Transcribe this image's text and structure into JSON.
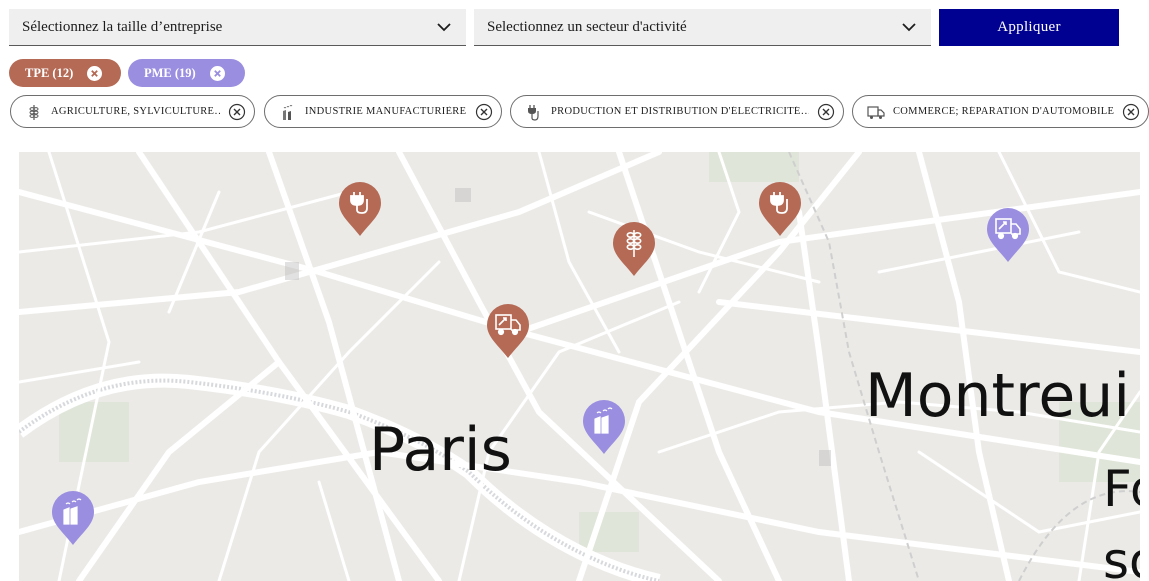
{
  "filters": {
    "size_select": {
      "label": "Sélectionnez la taille d’entreprise"
    },
    "sector_select": {
      "label": "Selectionnez un secteur d'activité"
    },
    "apply_label": "Appliquer"
  },
  "size_chips": [
    {
      "label": "TPE (12)",
      "color": "#b46a55"
    },
    {
      "label": "PME (19)",
      "color": "#9a8ee0"
    }
  ],
  "sector_tags": [
    {
      "label": "AGRICULTURE, SYLVICULTURE…",
      "icon": "wheat-icon"
    },
    {
      "label": "INDUSTRIE MANUFACTURIÈRE",
      "icon": "factory-icon"
    },
    {
      "label": "PRODUCTION ET DISTRIBUTION D'ÉLECTRICITÉ…",
      "icon": "plug-icon"
    },
    {
      "label": "COMMERCE; RÉPARATION D'AUTOMOBILES…",
      "icon": "delivery-truck-icon"
    }
  ],
  "map": {
    "labels": {
      "paris": "Paris",
      "montreuil": "Montreui",
      "fo": "Fo",
      "so": "so"
    },
    "colors": {
      "tpe": "#b46a55",
      "pme": "#9a8ee0",
      "background": "#ebeae7",
      "roads": "#ffffff"
    },
    "markers": [
      {
        "category": "TPE",
        "icon": "plug-icon"
      },
      {
        "category": "TPE",
        "icon": "plug-icon"
      },
      {
        "category": "TPE",
        "icon": "wheat-icon"
      },
      {
        "category": "TPE",
        "icon": "delivery-truck-icon"
      },
      {
        "category": "PME",
        "icon": "delivery-truck-icon"
      },
      {
        "category": "PME",
        "icon": "factory-icon"
      },
      {
        "category": "PME",
        "icon": "factory-icon"
      }
    ]
  }
}
